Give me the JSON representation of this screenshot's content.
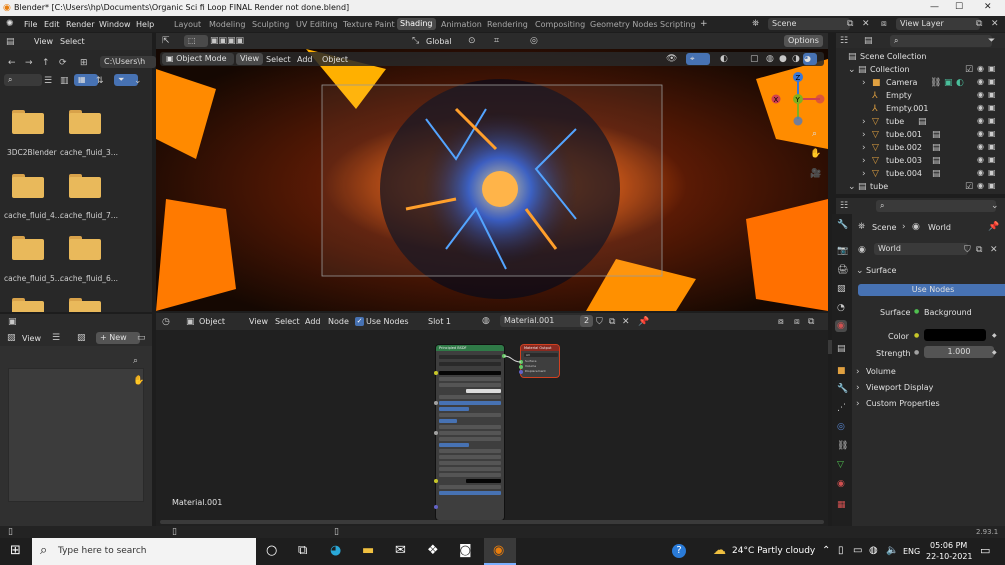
{
  "window": {
    "title": "Blender* [C:\\Users\\hp\\Documents\\Organic Sci fi Loop FINAL Render not done.blend]"
  },
  "menus": [
    "File",
    "Edit",
    "Render",
    "Window",
    "Help"
  ],
  "workspaces": [
    "Layout",
    "Modeling",
    "Sculpting",
    "UV Editing",
    "Texture Paint",
    "Shading",
    "Animation",
    "Rendering",
    "Compositing",
    "Geometry Nodes",
    "Scripting"
  ],
  "active_workspace": "Shading",
  "scene": {
    "name": "Scene",
    "view_layer": "View Layer"
  },
  "file_browser": {
    "menu": [
      "View",
      "Select"
    ],
    "path": "C:\\Users\\h",
    "folders": [
      "3DC2Blender",
      "cache_fluid_3...",
      "cache_fluid_4...",
      "cache_fluid_7...",
      "cache_fluid_5...",
      "cache_fluid_6..."
    ]
  },
  "viewport": {
    "mode": "Object Mode",
    "menu": [
      "View",
      "Select",
      "Add",
      "Object"
    ],
    "orientation": "Global",
    "options": "Options",
    "axes": {
      "x": "X",
      "y": "Y",
      "z": "Z"
    }
  },
  "outliner": {
    "root": "Scene Collection",
    "items": [
      {
        "name": "Collection",
        "level": 1
      },
      {
        "name": "Camera",
        "level": 2
      },
      {
        "name": "Empty",
        "level": 2
      },
      {
        "name": "Empty.001",
        "level": 2
      },
      {
        "name": "tube",
        "level": 2
      },
      {
        "name": "tube.001",
        "level": 2
      },
      {
        "name": "tube.002",
        "level": 2
      },
      {
        "name": "tube.003",
        "level": 2
      },
      {
        "name": "tube.004",
        "level": 2
      },
      {
        "name": "tube",
        "level": 1
      }
    ]
  },
  "properties": {
    "breadcrumb": [
      "Scene",
      "World"
    ],
    "world_name": "World",
    "surface_section": "Surface",
    "use_nodes": "Use Nodes",
    "surface_label": "Surface",
    "surface_value": "Background",
    "color_label": "Color",
    "strength_label": "Strength",
    "strength_value": "1.000",
    "sections": [
      "Volume",
      "Viewport Display",
      "Custom Properties"
    ]
  },
  "image_editor": {
    "view": "View",
    "new": "New"
  },
  "node_editor": {
    "type": "Object",
    "menu": [
      "View",
      "Select",
      "Add",
      "Node"
    ],
    "use_nodes": "Use Nodes",
    "slot": "Slot 1",
    "material": "Material.001",
    "users": "2",
    "material_label": "Material.001",
    "bsdf_title": "Principled BSDF",
    "output_title": "Material Output",
    "output_sockets": [
      "Surface",
      "Volume",
      "Displacement"
    ],
    "output_target": "All"
  },
  "status": {
    "version": "2.93.1"
  },
  "taskbar": {
    "search_placeholder": "Type here to search",
    "weather": "24°C  Partly cloudy",
    "lang": "ENG",
    "time": "05:06 PM",
    "date": "22-10-2021"
  }
}
